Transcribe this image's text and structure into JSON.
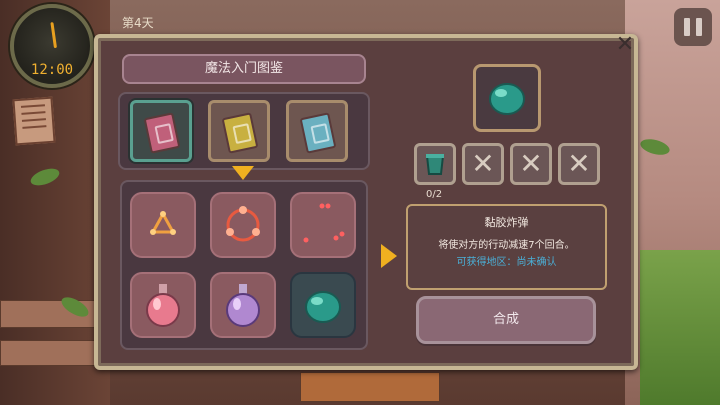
{
  "hud": {
    "time": "12:00",
    "day_label": "第4天",
    "pause_icon": "pause-icon"
  },
  "panel": {
    "title": "魔法入门图鉴",
    "close_icon": "close-icon"
  },
  "books": [
    {
      "icon": "spellbook-icon",
      "color": "#c0607a",
      "selected": true
    },
    {
      "icon": "spellbook-icon",
      "color": "#c8b040",
      "selected": false
    },
    {
      "icon": "spellbook-icon",
      "color": "#6ab0c0",
      "selected": false
    }
  ],
  "items": [
    {
      "icon": "triangle-rune-icon",
      "selected": false
    },
    {
      "icon": "circle-rune-icon",
      "selected": false
    },
    {
      "icon": "dots-rune-icon",
      "selected": false
    },
    {
      "icon": "pink-potion-icon",
      "selected": false
    },
    {
      "icon": "purple-potion-icon",
      "selected": false
    },
    {
      "icon": "slime-bomb-icon",
      "selected": true
    }
  ],
  "recipe": {
    "result_icon": "slime-bomb-icon",
    "ingredients": [
      {
        "icon": "teal-cup-icon",
        "empty": false
      },
      {
        "icon": "x-icon",
        "empty": true
      },
      {
        "icon": "x-icon",
        "empty": true
      },
      {
        "icon": "x-icon",
        "empty": true
      }
    ],
    "counter": "0/2",
    "name": "黏胶炸弹",
    "description": "将使对方的行动减速7个回合。",
    "source": "可获得地区：尚未确认",
    "craft_label": "合成"
  },
  "colors": {
    "accent_yellow": "#f0b020",
    "source_blue": "#4ab0d8",
    "panel_bg": "#5b3f3f"
  }
}
